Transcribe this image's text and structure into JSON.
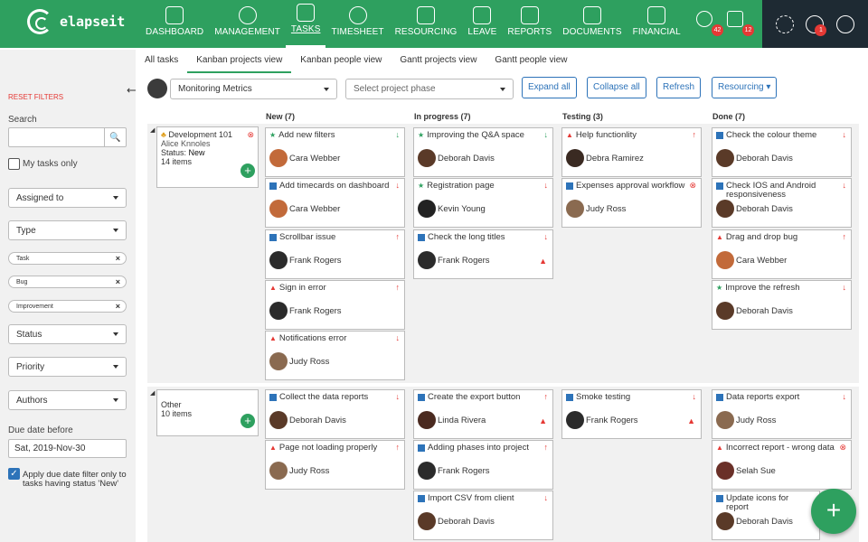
{
  "brand": {
    "name": "elapseit",
    "color": "#2ea05f"
  },
  "nav": [
    {
      "label": "DASHBOARD",
      "icon": "dashboard-icon"
    },
    {
      "label": "MANAGEMENT",
      "icon": "globe-icon"
    },
    {
      "label": "TASKS",
      "icon": "tasks-icon",
      "active": true
    },
    {
      "label": "TIMESHEET",
      "icon": "stopwatch-icon"
    },
    {
      "label": "RESOURCING",
      "icon": "people-icon"
    },
    {
      "label": "LEAVE",
      "icon": "calendar-icon"
    },
    {
      "label": "REPORTS",
      "icon": "chart-icon"
    },
    {
      "label": "DOCUMENTS",
      "icon": "document-icon"
    },
    {
      "label": "FINANCIAL",
      "icon": "wallet-icon"
    }
  ],
  "alerts": {
    "timer_count": "42",
    "calendar_count": "12",
    "help_count": "1"
  },
  "subnav": [
    "All tasks",
    "Kanban projects view",
    "Kanban people view",
    "Gantt projects view",
    "Gantt people view"
  ],
  "sidebar": {
    "reset": "RESET FILTERS",
    "search_label": "Search",
    "my_tasks": "My tasks only",
    "assigned_to": "Assigned to",
    "type": "Type",
    "type_tags": [
      "Task",
      "Bug",
      "Improvement"
    ],
    "status": "Status",
    "priority": "Priority",
    "authors": "Authors",
    "due_label": "Due date before",
    "due_value": "Sat, 2019-Nov-30",
    "apply_filter": "Apply due date filter only to tasks having status 'New'"
  },
  "toolbar": {
    "project": "Monitoring Metrics",
    "phase_placeholder": "Select project phase",
    "expand": "Expand all",
    "collapse": "Collapse all",
    "refresh": "Refresh",
    "resourcing": "Resourcing"
  },
  "columns": [
    "New (7)",
    "In progress (7)",
    "Testing (3)",
    "Done (7)"
  ],
  "lanes": [
    {
      "name": "Development 101",
      "owner": "Alice Knnoles",
      "status_label": "Status:",
      "status": "New",
      "items": "14 items"
    },
    {
      "name": "Other",
      "items": "10 items"
    }
  ],
  "cards": [
    {
      "title": "Add new filters",
      "type": "imp",
      "prio": "↓",
      "assignee": "Cara Webber"
    },
    {
      "title": "Add timecards on dashboard",
      "type": "task",
      "prio": "↓",
      "assignee": "Cara Webber"
    },
    {
      "title": "Scrollbar issue",
      "type": "task",
      "prio": "↑",
      "assignee": "Frank Rogers"
    },
    {
      "title": "Sign in error",
      "type": "bug",
      "prio": "↑",
      "assignee": "Frank Rogers"
    },
    {
      "title": "Notifications error",
      "type": "bug",
      "prio": "↓",
      "assignee": "Judy Ross"
    },
    {
      "title": "Improving the Q&A space",
      "type": "imp",
      "prio": "↓",
      "assignee": "Deborah Davis"
    },
    {
      "title": "Registration page",
      "type": "imp",
      "prio": "↓",
      "assignee": "Kevin Young"
    },
    {
      "title": "Check the long titles",
      "type": "task",
      "prio": "↓",
      "assignee": "Frank Rogers"
    },
    {
      "title": "Help functionlity",
      "type": "bug",
      "prio": "↑",
      "assignee": "Debra Ramirez"
    },
    {
      "title": "Expenses approval workflow",
      "type": "task",
      "prio": "⊗",
      "assignee": "Judy Ross"
    },
    {
      "title": "Check the colour theme",
      "type": "task",
      "prio": "↓",
      "assignee": "Deborah Davis"
    },
    {
      "title": "Check IOS and Android responsiveness",
      "type": "task",
      "prio": "↓",
      "assignee": "Deborah Davis"
    },
    {
      "title": "Drag and drop bug",
      "type": "bug",
      "prio": "↑",
      "assignee": "Cara Webber"
    },
    {
      "title": "Improve the refresh",
      "type": "imp",
      "prio": "↓",
      "assignee": "Deborah Davis"
    },
    {
      "title": "Collect the data reports",
      "type": "task",
      "prio": "↓",
      "assignee": "Deborah Davis"
    },
    {
      "title": "Page not loading properly",
      "type": "bug",
      "prio": "↑",
      "assignee": "Judy Ross"
    },
    {
      "title": "Create the export button",
      "type": "task",
      "prio": "↑",
      "assignee": "Linda Rivera"
    },
    {
      "title": "Adding phases into project",
      "type": "task",
      "prio": "↑",
      "assignee": "Frank Rogers"
    },
    {
      "title": "Import CSV from client",
      "type": "task",
      "prio": "↓",
      "assignee": "Deborah Davis"
    },
    {
      "title": "Smoke testing",
      "type": "task",
      "prio": "↓",
      "assignee": "Frank Rogers"
    },
    {
      "title": "Data reports export",
      "type": "task",
      "prio": "↓",
      "assignee": "Judy Ross"
    },
    {
      "title": "Incorrect report - wrong data",
      "type": "bug",
      "prio": "⊗",
      "assignee": "Selah Sue"
    },
    {
      "title": "Update icons for report",
      "type": "task",
      "prio": "",
      "assignee": "Deborah Davis"
    }
  ]
}
